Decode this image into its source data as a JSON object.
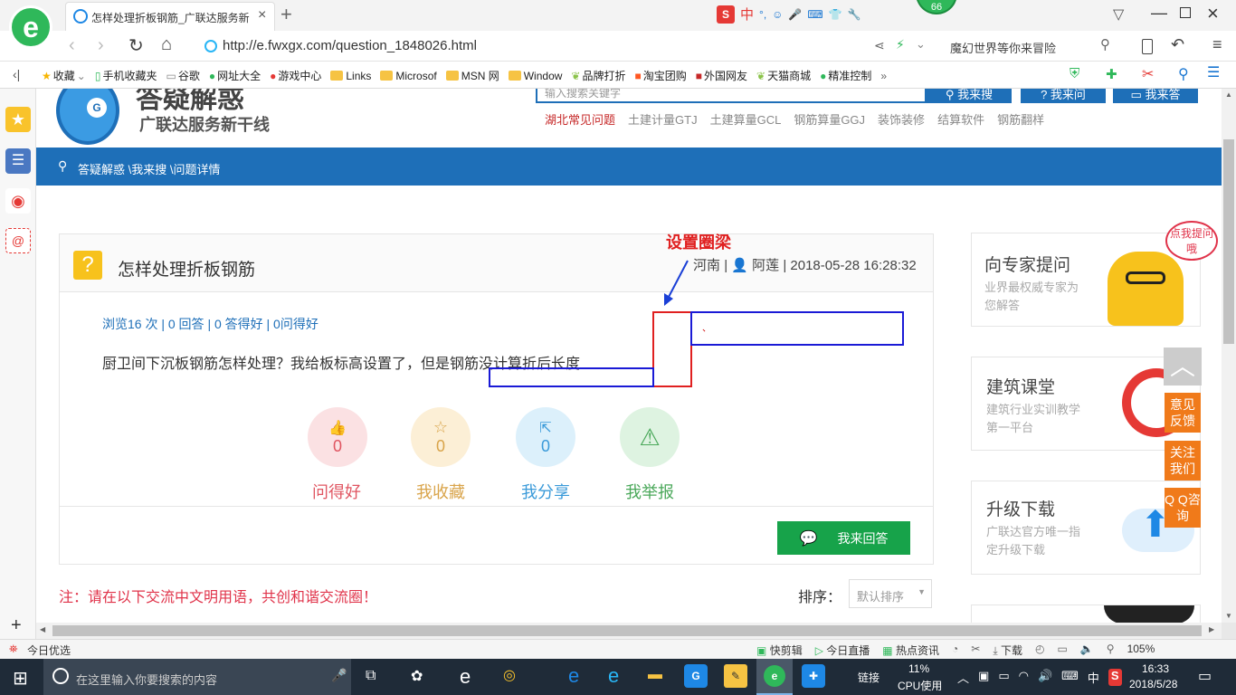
{
  "browser": {
    "tab_title": "怎样处理折板钢筋_广联达服务新",
    "url": "http://e.fwxgx.com/question_1848026.html",
    "search_placeholder": "魔幻世界等你来冒险",
    "badge_count": "66",
    "ime_label": "中",
    "favorites": [
      "收藏",
      "手机收藏夹",
      "谷歌",
      "网址大全",
      "游戏中心",
      "Links",
      "Microsof",
      "MSN 网",
      "Window",
      "品牌打折",
      "淘宝团购",
      "外国网友",
      "天猫商城",
      "精准控制"
    ]
  },
  "header": {
    "logo_title": "答疑解惑",
    "logo_subtitle": "广联达服务新干线",
    "search_placeholder": "输入搜索关键字",
    "search_btn": "我来搜",
    "ask_btn": "我来问",
    "answer_btn": "我来答",
    "hot_links": [
      "湖北常见问题",
      "土建计量GTJ",
      "土建算量GCL",
      "钢筋算量GGJ",
      "装饰装修",
      "结算软件",
      "钢筋翻样"
    ]
  },
  "breadcrumb": "答疑解惑 \\我来搜 \\问题详情",
  "question": {
    "title": "怎样处理折板钢筋",
    "region": "河南",
    "author": "阿莲",
    "datetime": "2018-05-28 16:28:32",
    "stats": "浏览16 次 | 0 回答 | 0 答得好 | 0问得好",
    "body": "厨卫间下沉板钢筋怎样处理？我给板标高设置了，但是钢筋没计算折后长度",
    "annotation": "设置圈梁",
    "dot_mark": "、"
  },
  "actions": [
    {
      "label": "问得好",
      "count": "0",
      "icon": "thumbs-up-icon",
      "color": "#e05561",
      "bg": "#fbe1e3"
    },
    {
      "label": "我收藏",
      "count": "0",
      "icon": "star-icon",
      "color": "#d9a44a",
      "bg": "#fcefd6"
    },
    {
      "label": "我分享",
      "count": "0",
      "icon": "share-icon",
      "color": "#3a9ad9",
      "bg": "#dcf0fb"
    },
    {
      "label": "我举报",
      "count": "",
      "icon": "warning-icon",
      "color": "#4aa85a",
      "bg": "#def3e1"
    }
  ],
  "answer_btn": "我来回答",
  "notice": "注：请在以下交流中文明用语，共创和谐交流圈！",
  "sort": {
    "label": "排序：",
    "value": "默认排序"
  },
  "right_cards": [
    {
      "title": "向专家提问",
      "desc": "业界最权威专家为您解答",
      "bubble": "点我提问哦"
    },
    {
      "title": "建筑课堂",
      "desc": "建筑行业实训教学第一平台"
    },
    {
      "title": "升级下载",
      "desc": "广联达官方唯一指定升级下载"
    }
  ],
  "float_btns": [
    "意见反馈",
    "关注我们",
    "Q Q咨询"
  ],
  "statusbar": {
    "left": "今日优选",
    "items": [
      "快剪辑",
      "今日直播",
      "热点资讯",
      "下载"
    ],
    "zoom": "105%"
  },
  "taskbar": {
    "search_placeholder": "在这里输入你要搜索的内容",
    "network": "链接",
    "cpu_value": "11%",
    "cpu_label": "CPU使用",
    "ime": "中",
    "time": "16:33",
    "date": "2018/5/28"
  }
}
